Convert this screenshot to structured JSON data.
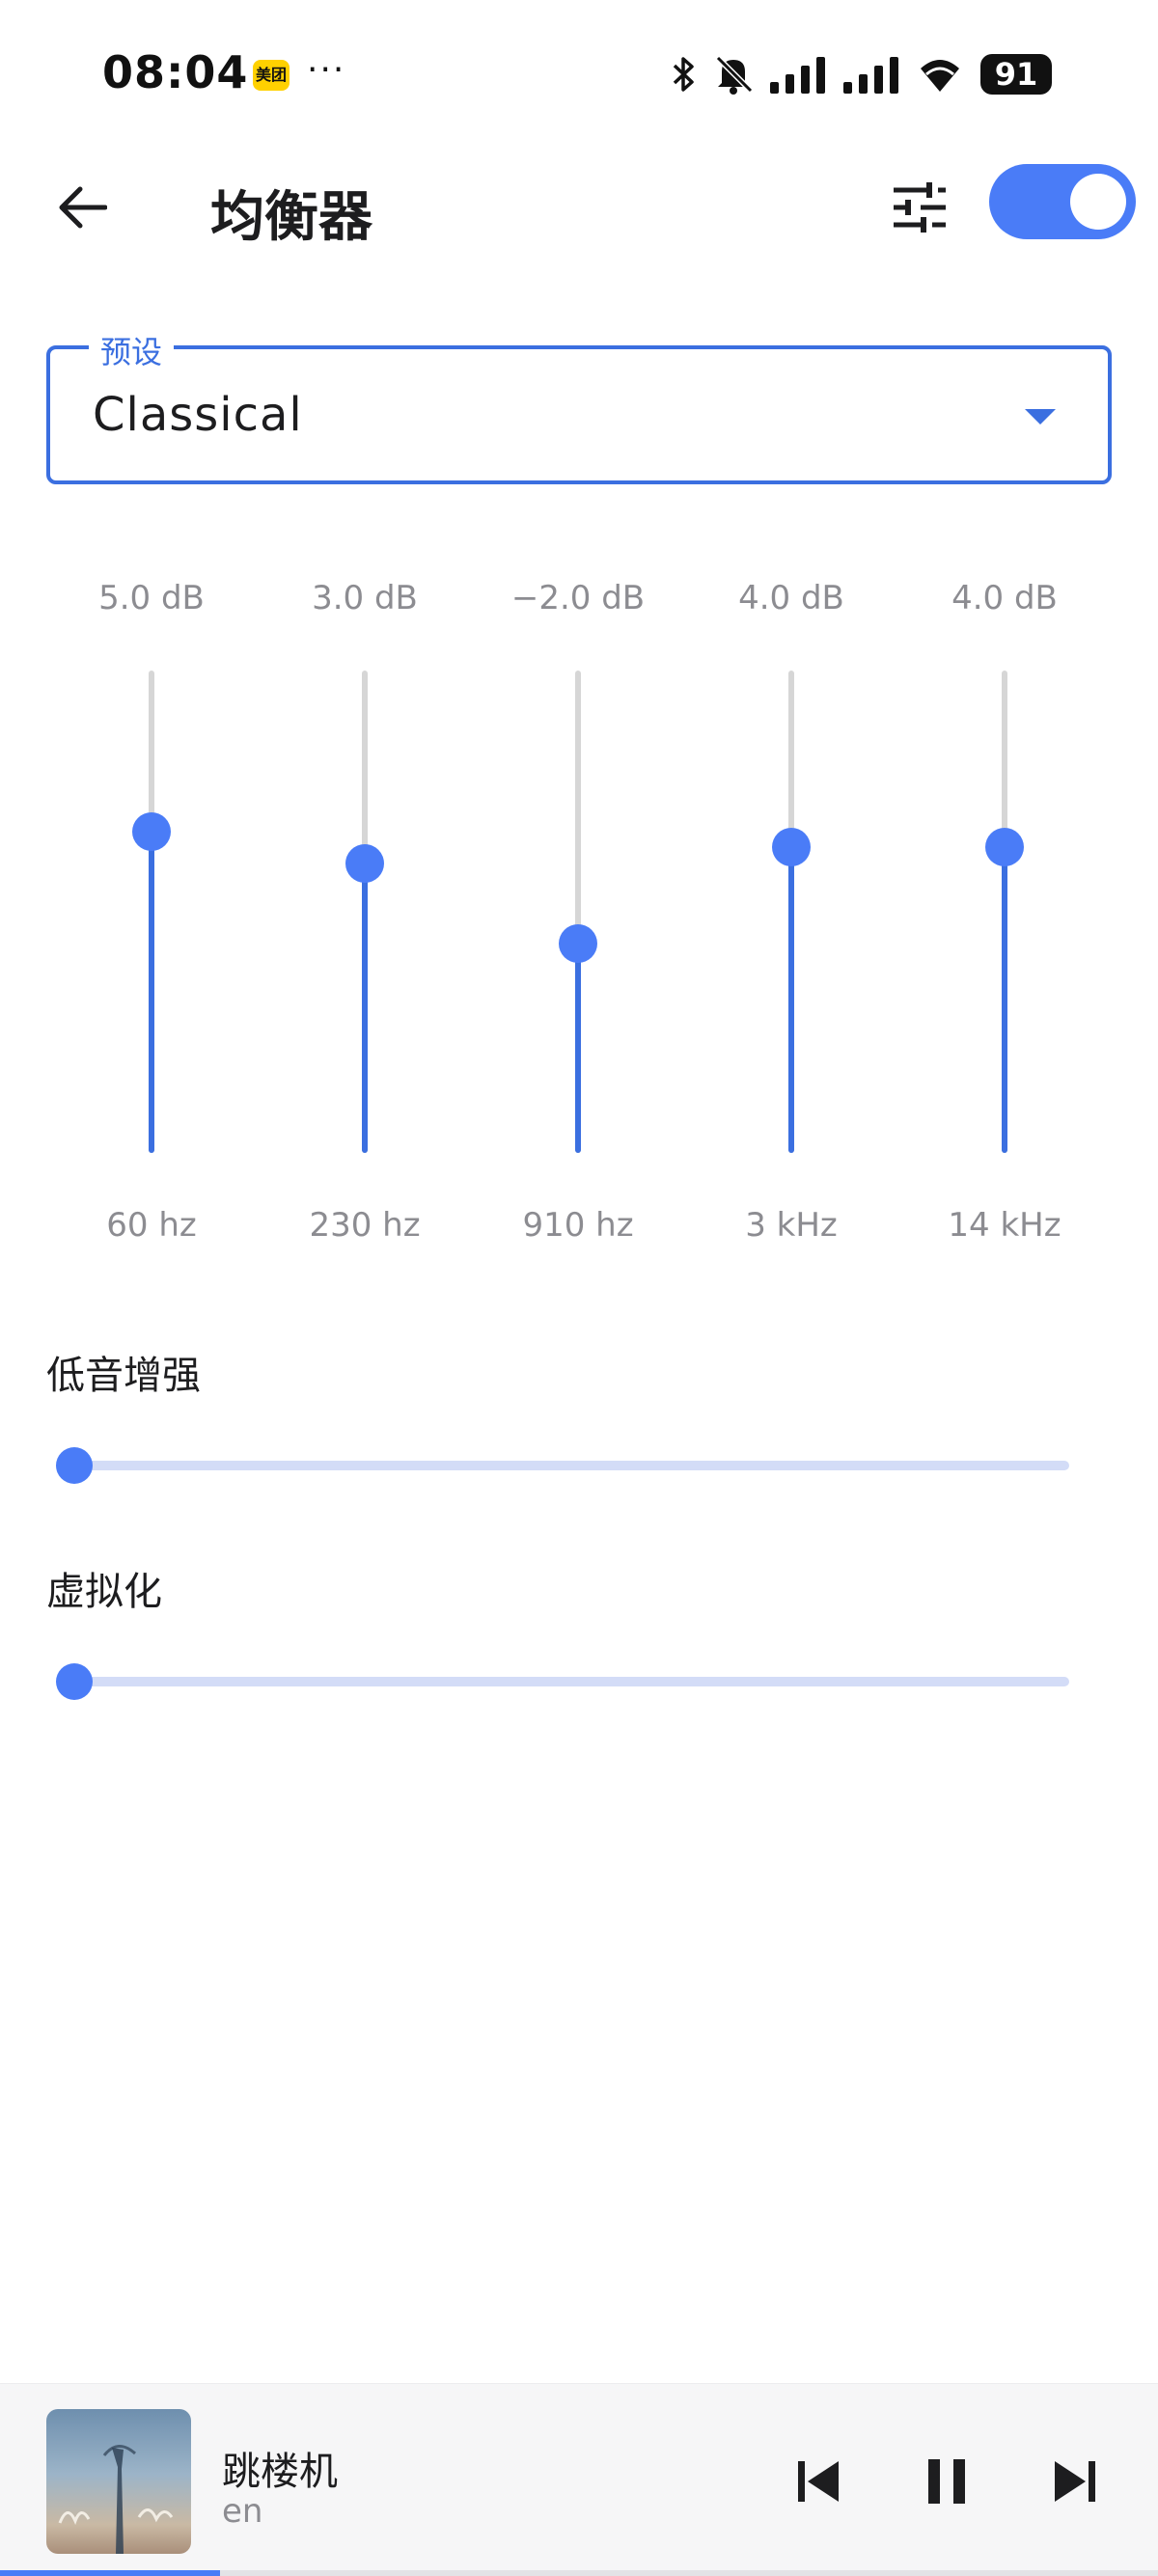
{
  "status_bar": {
    "time": "08:04",
    "app_badge": "美团",
    "more_indicator": "···",
    "battery_level": "91",
    "icons": [
      "bluetooth-icon",
      "mute-icon",
      "signal-icon",
      "signal-icon",
      "wifi-icon",
      "battery-icon"
    ]
  },
  "app_bar": {
    "title": "均衡器",
    "back_icon": "arrow-left-icon",
    "tune_icon": "sliders-icon",
    "equalizer_enabled": true
  },
  "preset": {
    "label": "预设",
    "value": "Classical"
  },
  "eq_range_db": [
    -15,
    15
  ],
  "eq_bands": [
    {
      "db_label": "5.0 dB",
      "db": 5.0,
      "freq_label": "60 hz"
    },
    {
      "db_label": "3.0 dB",
      "db": 3.0,
      "freq_label": "230 hz"
    },
    {
      "db_label": "−2.0 dB",
      "db": -2.0,
      "freq_label": "910 hz"
    },
    {
      "db_label": "4.0 dB",
      "db": 4.0,
      "freq_label": "3 kHz"
    },
    {
      "db_label": "4.0 dB",
      "db": 4.0,
      "freq_label": "14 kHz"
    }
  ],
  "effects": [
    {
      "label": "低音增强",
      "level": 0
    },
    {
      "label": "虚拟化",
      "level": 0
    }
  ],
  "colors": {
    "accent": "#4a7cf7",
    "accent_dark": "#3b6fe0",
    "track_inactive": "#d6d6d6",
    "effect_track": "#d3dcf7",
    "muted_text": "#8c8c91"
  },
  "mini_player": {
    "title": "跳楼机",
    "artist": "en",
    "controls": [
      "skip-previous-icon",
      "pause-icon",
      "skip-next-icon"
    ],
    "progress": 0.19
  }
}
